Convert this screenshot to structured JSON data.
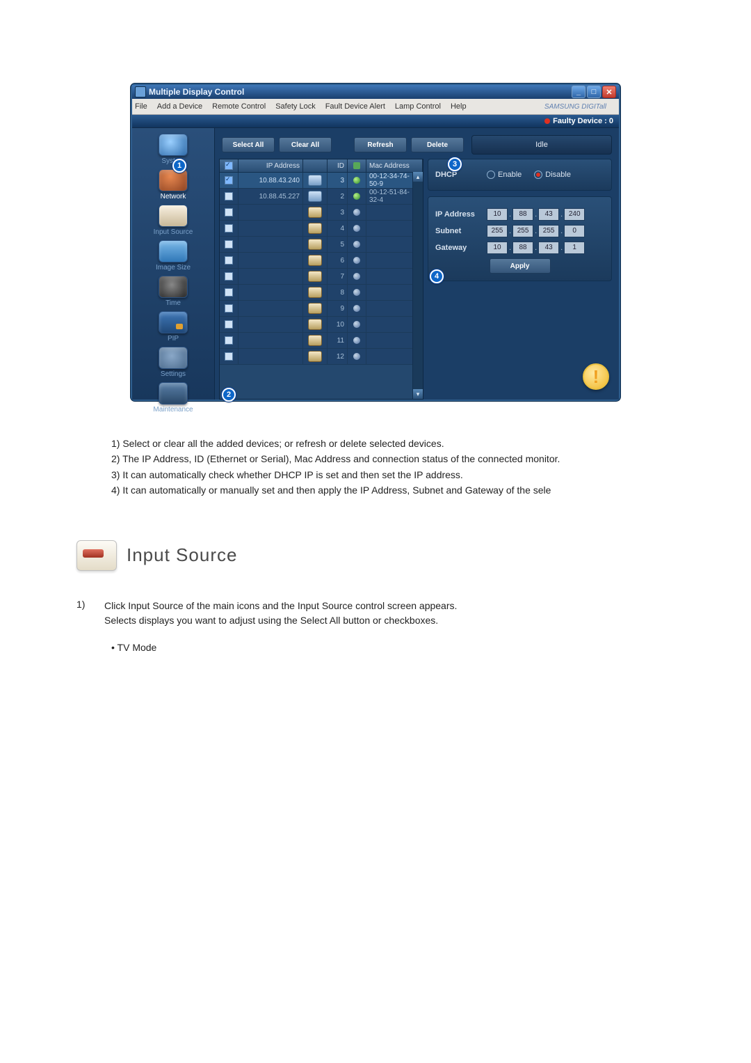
{
  "window": {
    "title": "Multiple Display Control",
    "brand": "SAMSUNG DIGITall"
  },
  "menu": [
    "File",
    "Add a Device",
    "Remote Control",
    "Safety Lock",
    "Fault Device Alert",
    "Lamp Control",
    "Help"
  ],
  "faulty_label": "Faulty Device : 0",
  "toolbar": {
    "select_all": "Select All",
    "clear_all": "Clear All",
    "refresh": "Refresh",
    "delete": "Delete",
    "idle": "Idle"
  },
  "sidebar": {
    "items": [
      {
        "label": "System"
      },
      {
        "label": "Network"
      },
      {
        "label": "Input Source"
      },
      {
        "label": "Image Size"
      },
      {
        "label": "Time"
      },
      {
        "label": "PIP"
      },
      {
        "label": "Settings"
      },
      {
        "label": "Maintenance"
      }
    ]
  },
  "table": {
    "headers": {
      "ip": "IP Address",
      "id": "ID",
      "mac": "Mac Address"
    },
    "rows": [
      {
        "checked": true,
        "ip": "10.88.43.240",
        "type": "eth",
        "id": "3",
        "status": "on",
        "mac": "00-12-34-74-50-9"
      },
      {
        "checked": false,
        "ip": "10.88.45.227",
        "type": "eth",
        "id": "2",
        "status": "on",
        "mac": "00-12-51-84-32-4"
      },
      {
        "checked": false,
        "ip": "",
        "type": "ser",
        "id": "3",
        "status": "off",
        "mac": ""
      },
      {
        "checked": false,
        "ip": "",
        "type": "ser",
        "id": "4",
        "status": "off",
        "mac": ""
      },
      {
        "checked": false,
        "ip": "",
        "type": "ser",
        "id": "5",
        "status": "off",
        "mac": ""
      },
      {
        "checked": false,
        "ip": "",
        "type": "ser",
        "id": "6",
        "status": "off",
        "mac": ""
      },
      {
        "checked": false,
        "ip": "",
        "type": "ser",
        "id": "7",
        "status": "off",
        "mac": ""
      },
      {
        "checked": false,
        "ip": "",
        "type": "ser",
        "id": "8",
        "status": "off",
        "mac": ""
      },
      {
        "checked": false,
        "ip": "",
        "type": "ser",
        "id": "9",
        "status": "off",
        "mac": ""
      },
      {
        "checked": false,
        "ip": "",
        "type": "ser",
        "id": "10",
        "status": "off",
        "mac": ""
      },
      {
        "checked": false,
        "ip": "",
        "type": "ser",
        "id": "11",
        "status": "off",
        "mac": ""
      },
      {
        "checked": false,
        "ip": "",
        "type": "ser",
        "id": "12",
        "status": "off",
        "mac": ""
      }
    ]
  },
  "net_settings": {
    "dhcp_label": "DHCP",
    "enable": "Enable",
    "disable": "Disable",
    "dhcp_value": "disable",
    "ip_label": "IP Address",
    "ip": [
      "10",
      "88",
      "43",
      "240"
    ],
    "subnet_label": "Subnet",
    "subnet": [
      "255",
      "255",
      "255",
      "0"
    ],
    "gateway_label": "Gateway",
    "gateway": [
      "10",
      "88",
      "43",
      "1"
    ],
    "apply": "Apply"
  },
  "callouts": {
    "c1": "1",
    "c2": "2",
    "c3": "3",
    "c4": "4"
  },
  "desc": {
    "l1": "1)  Select or clear all the added devices; or refresh or delete selected devices.",
    "l2": "2)  The IP Address, ID (Ethernet or Serial), Mac Address and connection status of the connected monitor.",
    "l3": "3)  It can automatically check whether DHCP IP is set and then set the IP address.",
    "l4": "4)  It can automatically or manually set and then apply the IP Address, Subnet and Gateway of the sele"
  },
  "section": {
    "title": "Input Source"
  },
  "note": {
    "num": "1)",
    "line1": "Click Input Source of the main icons and the Input Source control screen appears.",
    "line2": "Selects displays you want to adjust using the Select All button or checkboxes.",
    "bullet": "•  TV Mode"
  }
}
